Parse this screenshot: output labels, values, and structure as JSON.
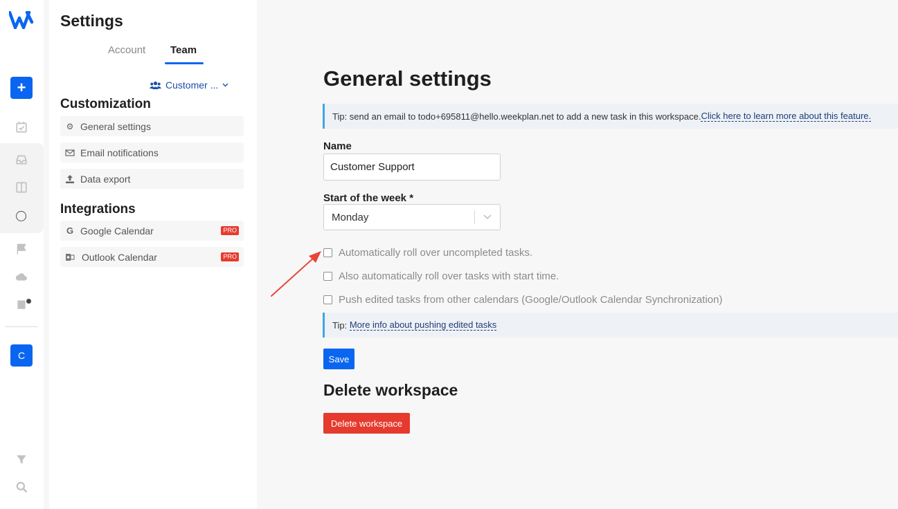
{
  "sidebar_rail": {
    "workspace_initial": "C",
    "icons": [
      "logo-icon",
      "plus-icon",
      "calendar-check-icon",
      "inbox-icon",
      "columns-icon",
      "circle-icon",
      "flag-icon",
      "cloud-icon",
      "archive-icon",
      "filter-icon",
      "search-icon"
    ],
    "accent_color": "#0a66f0"
  },
  "settings_panel": {
    "title": "Settings",
    "tabs": [
      {
        "label": "Account",
        "active": false
      },
      {
        "label": "Team",
        "active": true
      }
    ],
    "workspace_selector": "Customer ...",
    "customization": {
      "heading": "Customization",
      "items": [
        {
          "label": "General settings",
          "icon": "gear-icon"
        },
        {
          "label": "Email notifications",
          "icon": "envelope-icon"
        },
        {
          "label": "Data export",
          "icon": "upload-icon"
        }
      ]
    },
    "integrations": {
      "heading": "Integrations",
      "items": [
        {
          "label": "Google Calendar",
          "icon": "google-icon",
          "badge": "PRO"
        },
        {
          "label": "Outlook Calendar",
          "icon": "outlook-icon",
          "badge": "PRO"
        }
      ]
    }
  },
  "main": {
    "title": "General settings",
    "email_tip": {
      "text": "Tip: send an email to todo+695811@hello.weekplan.net to add a new task in this workspace.",
      "link": "Click here to learn more about this feature."
    },
    "name_field": {
      "label": "Name",
      "value": "Customer Support"
    },
    "week_start": {
      "label": "Start of the week *",
      "value": "Monday"
    },
    "checkboxes": [
      {
        "label": "Automatically roll over uncompleted tasks.",
        "checked": false
      },
      {
        "label": "Also automatically roll over tasks with start time.",
        "checked": false
      },
      {
        "label": "Push edited tasks from other calendars (Google/Outlook Calendar Synchronization)",
        "checked": false
      }
    ],
    "push_tip": {
      "prefix": "Tip: ",
      "link": "More info about pushing edited tasks"
    },
    "save_label": "Save",
    "delete_section": {
      "title": "Delete workspace",
      "button_label": "Delete workspace"
    },
    "colors": {
      "primary": "#0a66f0",
      "danger": "#e63a2e",
      "tip_border": "#3ea8e0",
      "annotation_arrow": "#e8463a"
    }
  }
}
